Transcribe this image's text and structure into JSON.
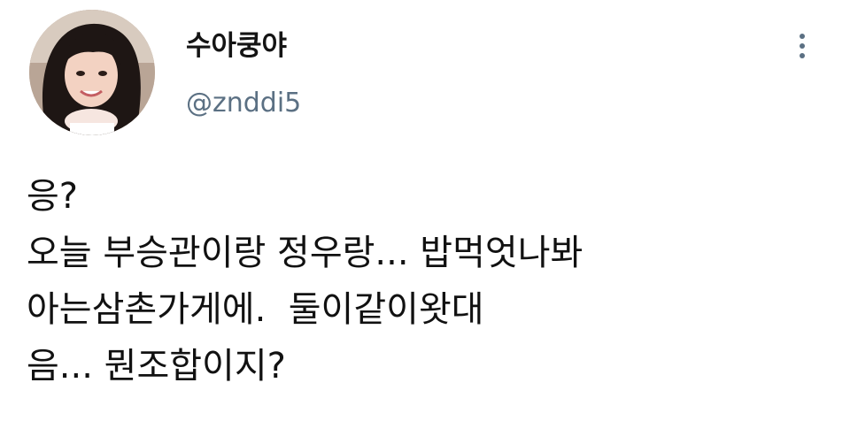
{
  "user": {
    "display_name": "수아쿵야",
    "handle": "@znddi5"
  },
  "menu": {
    "icon": "more-vertical-icon"
  },
  "tweet": {
    "lines": [
      "응?",
      "오늘 부승관이랑 정우랑... 밥먹엇나봐",
      "아는삼촌가게에.  둘이같이왓대",
      "음... 뭔조합이지?"
    ]
  },
  "colors": {
    "text_primary": "#111111",
    "text_secondary": "#5b7083",
    "background": "#ffffff"
  }
}
